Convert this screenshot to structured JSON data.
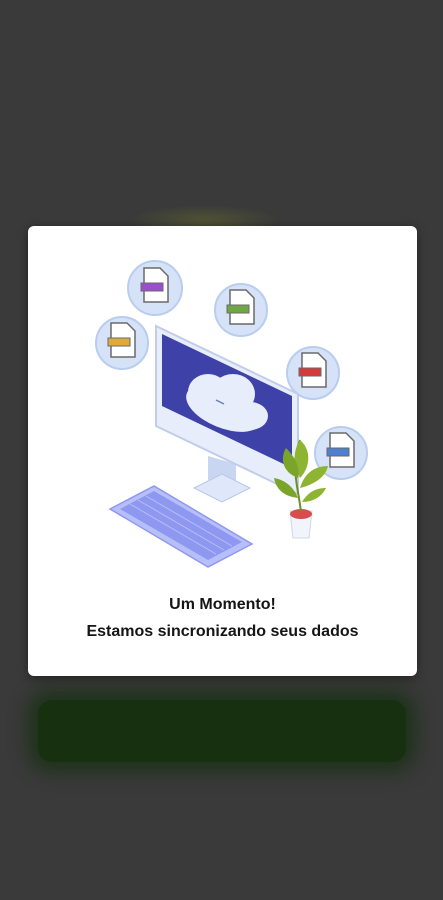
{
  "dialog": {
    "title": "Um Momento!",
    "subtitle": "Estamos sincronizando seus dados",
    "illustration": "computer-cloud-sync-icon"
  },
  "background": {
    "button_label": ""
  },
  "colors": {
    "overlay": "#3a3a3a",
    "dialog_bg": "#ffffff",
    "monitor_screen": "#3e42a8",
    "keyboard": "#8f98f0",
    "plant": "#8db532",
    "bg_button": "#163010"
  }
}
